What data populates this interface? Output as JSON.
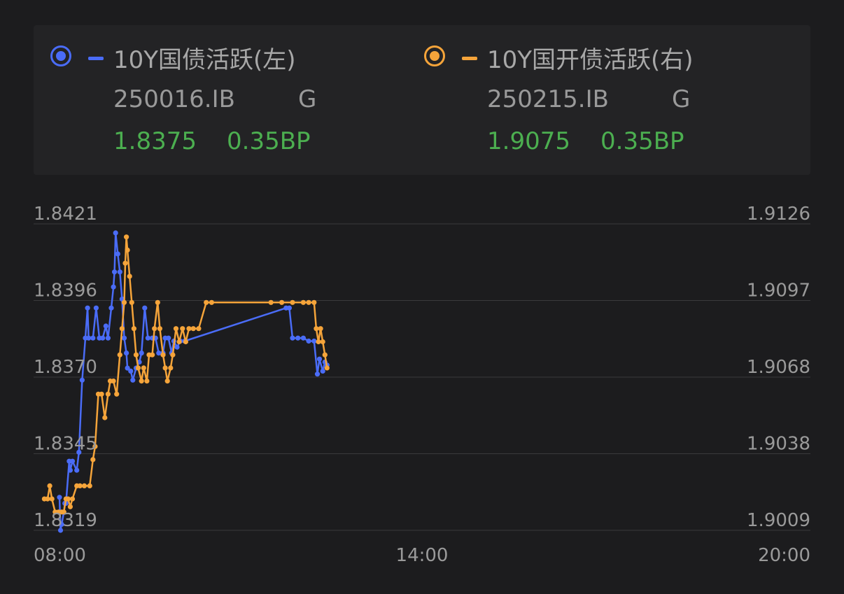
{
  "legend": {
    "left": {
      "name": "10Y国债活跃(左)",
      "code": "250016.IB",
      "grade": "G",
      "yield": "1.8375",
      "change": "0.35BP",
      "color": "#4a6cf7"
    },
    "right": {
      "name": "10Y国开债活跃(右)",
      "code": "250215.IB",
      "grade": "G",
      "yield": "1.9075",
      "change": "0.35BP",
      "color": "#f5a43a"
    }
  },
  "colors": {
    "background": "#1c1c1e",
    "panel": "#232325",
    "grid": "#3a3a3c",
    "up": "#4caf50"
  },
  "chart_data": {
    "type": "line",
    "x_axis": {
      "range": [
        "08:00",
        "20:00"
      ],
      "tick_labels": [
        "08:00",
        "14:00",
        "20:00"
      ]
    },
    "y_left": {
      "range": [
        1.8319,
        1.8421
      ],
      "tick_labels": [
        "1.8421",
        "1.8396",
        "1.8370",
        "1.8345",
        "1.8319"
      ]
    },
    "y_right": {
      "range": [
        1.9009,
        1.9126
      ],
      "tick_labels": [
        "1.9126",
        "1.9097",
        "1.9068",
        "1.9038",
        "1.9009"
      ]
    },
    "grid": true,
    "series": [
      {
        "name": "10Y国债活跃(左)",
        "axis": "left",
        "color": "#4a6cf7",
        "points": [
          [
            "08:24",
            1.833
          ],
          [
            "08:25",
            1.8319
          ],
          [
            "08:26",
            1.8321
          ],
          [
            "08:28",
            1.8325
          ],
          [
            "08:29",
            1.8328
          ],
          [
            "08:30",
            1.8328
          ],
          [
            "08:33",
            1.8342
          ],
          [
            "08:34",
            1.8339
          ],
          [
            "08:36",
            1.8342
          ],
          [
            "08:40",
            1.8339
          ],
          [
            "08:42",
            1.8345
          ],
          [
            "08:45",
            1.8369
          ],
          [
            "08:48",
            1.8383
          ],
          [
            "08:50",
            1.8393
          ],
          [
            "08:51",
            1.8383
          ],
          [
            "08:55",
            1.8383
          ],
          [
            "08:58",
            1.8393
          ],
          [
            "09:01",
            1.8383
          ],
          [
            "09:04",
            1.8383
          ],
          [
            "09:07",
            1.8387
          ],
          [
            "09:09",
            1.8383
          ],
          [
            "09:12",
            1.8393
          ],
          [
            "09:14",
            1.84
          ],
          [
            "09:15",
            1.8405
          ],
          [
            "09:16",
            1.8418
          ],
          [
            "09:18",
            1.8411
          ],
          [
            "09:20",
            1.8405
          ],
          [
            "09:22",
            1.8396
          ],
          [
            "09:24",
            1.8383
          ],
          [
            "09:26",
            1.8378
          ],
          [
            "09:27",
            1.8373
          ],
          [
            "09:30",
            1.8372
          ],
          [
            "09:32",
            1.8369
          ],
          [
            "09:35",
            1.8373
          ],
          [
            "09:38",
            1.8375
          ],
          [
            "09:40",
            1.8378
          ],
          [
            "09:43",
            1.8393
          ],
          [
            "09:46",
            1.8383
          ],
          [
            "09:50",
            1.8383
          ],
          [
            "09:53",
            1.8383
          ],
          [
            "09:56",
            1.8378
          ],
          [
            "10:00",
            1.8378
          ],
          [
            "10:02",
            1.8383
          ],
          [
            "10:05",
            1.8383
          ],
          [
            "10:08",
            1.8378
          ],
          [
            "10:10",
            1.8382
          ],
          [
            "10:13",
            1.838
          ],
          [
            "10:16",
            1.8382
          ],
          [
            "10:20",
            1.8382
          ],
          [
            "11:54",
            1.8393
          ],
          [
            "11:57",
            1.8393
          ],
          [
            "12:00",
            1.8383
          ],
          [
            "12:05",
            1.8383
          ],
          [
            "12:10",
            1.8383
          ],
          [
            "12:15",
            1.8382
          ],
          [
            "12:20",
            1.8382
          ],
          [
            "12:23",
            1.8371
          ],
          [
            "12:25",
            1.8376
          ],
          [
            "12:28",
            1.8372
          ],
          [
            "12:30",
            1.8375
          ],
          [
            "12:32",
            1.8374
          ]
        ]
      },
      {
        "name": "10Y国开债活跃(右)",
        "axis": "right",
        "color": "#f5a43a",
        "points": [
          [
            "08:10",
            1.9021
          ],
          [
            "08:13",
            1.9021
          ],
          [
            "08:15",
            1.9026
          ],
          [
            "08:17",
            1.9021
          ],
          [
            "08:20",
            1.9016
          ],
          [
            "08:23",
            1.9016
          ],
          [
            "08:26",
            1.9016
          ],
          [
            "08:28",
            1.9016
          ],
          [
            "08:30",
            1.9021
          ],
          [
            "08:32",
            1.9021
          ],
          [
            "08:34",
            1.9018
          ],
          [
            "08:36",
            1.9021
          ],
          [
            "08:40",
            1.9026
          ],
          [
            "08:43",
            1.9026
          ],
          [
            "08:47",
            1.9026
          ],
          [
            "08:52",
            1.9026
          ],
          [
            "08:55",
            1.9036
          ],
          [
            "08:57",
            1.9041
          ],
          [
            "09:00",
            1.9061
          ],
          [
            "09:03",
            1.9061
          ],
          [
            "09:06",
            1.9052
          ],
          [
            "09:09",
            1.9061
          ],
          [
            "09:11",
            1.9066
          ],
          [
            "09:14",
            1.9066
          ],
          [
            "09:17",
            1.9061
          ],
          [
            "09:20",
            1.9076
          ],
          [
            "09:22",
            1.9086
          ],
          [
            "09:24",
            1.9096
          ],
          [
            "09:25",
            1.9111
          ],
          [
            "09:26",
            1.9121
          ],
          [
            "09:27",
            1.9116
          ],
          [
            "09:29",
            1.9106
          ],
          [
            "09:31",
            1.9096
          ],
          [
            "09:33",
            1.9086
          ],
          [
            "09:35",
            1.9076
          ],
          [
            "09:37",
            1.9071
          ],
          [
            "09:40",
            1.9066
          ],
          [
            "09:42",
            1.9071
          ],
          [
            "09:45",
            1.9066
          ],
          [
            "09:47",
            1.9076
          ],
          [
            "09:50",
            1.9076
          ],
          [
            "09:52",
            1.9086
          ],
          [
            "09:55",
            1.9096
          ],
          [
            "09:57",
            1.9086
          ],
          [
            "10:00",
            1.9076
          ],
          [
            "10:02",
            1.9071
          ],
          [
            "10:04",
            1.9066
          ],
          [
            "10:07",
            1.9071
          ],
          [
            "10:09",
            1.9076
          ],
          [
            "10:12",
            1.9086
          ],
          [
            "10:15",
            1.9081
          ],
          [
            "10:18",
            1.9086
          ],
          [
            "10:21",
            1.9081
          ],
          [
            "10:24",
            1.9086
          ],
          [
            "10:28",
            1.9086
          ],
          [
            "10:33",
            1.9086
          ],
          [
            "10:40",
            1.9096
          ],
          [
            "10:45",
            1.9096
          ],
          [
            "11:40",
            1.9096
          ],
          [
            "11:50",
            1.9096
          ],
          [
            "12:00",
            1.9096
          ],
          [
            "12:10",
            1.9096
          ],
          [
            "12:15",
            1.9096
          ],
          [
            "12:20",
            1.9096
          ],
          [
            "12:22",
            1.9086
          ],
          [
            "12:24",
            1.9081
          ],
          [
            "12:26",
            1.9086
          ],
          [
            "12:28",
            1.9081
          ],
          [
            "12:30",
            1.9076
          ],
          [
            "12:32",
            1.9071
          ]
        ]
      }
    ]
  }
}
